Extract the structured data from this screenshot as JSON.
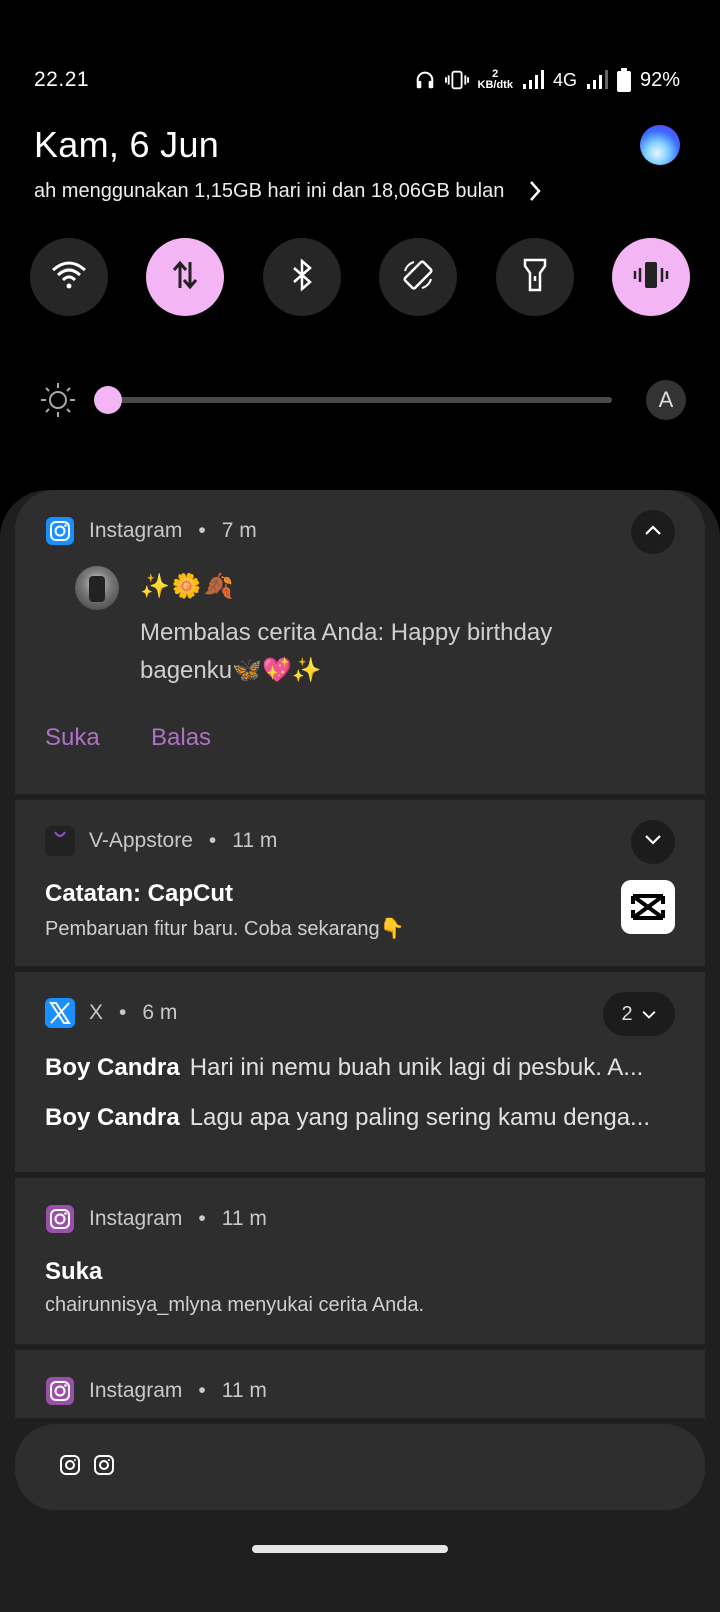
{
  "status": {
    "time": "22.21",
    "data_speed_value": "2",
    "data_speed_unit": "KB/dtk",
    "network": "4G",
    "battery": "92%"
  },
  "header": {
    "date": "Kam, 6 Jun",
    "data_usage": "ah menggunakan 1,15GB hari ini dan 18,06GB bulan"
  },
  "quick_toggles": [
    {
      "name": "wifi",
      "on": false
    },
    {
      "name": "mobile-data",
      "on": true
    },
    {
      "name": "bluetooth",
      "on": false
    },
    {
      "name": "auto-rotate",
      "on": false
    },
    {
      "name": "flashlight",
      "on": false
    },
    {
      "name": "vibrate",
      "on": true
    }
  ],
  "brightness": {
    "level": 0.0,
    "auto_label": "A"
  },
  "notifications": [
    {
      "app": "Instagram",
      "time": "7 m",
      "emoji_line": "✨🌼🍂",
      "message": "Membalas cerita Anda: Happy birthday bagenku🦋💖✨",
      "actions": [
        "Suka",
        "Balas"
      ]
    },
    {
      "app": "V-Appstore",
      "time": "11 m",
      "title": "Catatan: CapCut",
      "text": "Pembaruan fitur baru. Coba sekarang👇"
    },
    {
      "app": "X",
      "time": "6 m",
      "count": "2",
      "lines": [
        {
          "sender": "Boy Candra",
          "text": "Hari ini nemu buah unik lagi di pesbuk. A..."
        },
        {
          "sender": "Boy Candra",
          "text": "Lagu apa yang paling sering kamu denga..."
        }
      ]
    },
    {
      "app": "Instagram",
      "time": "11 m",
      "title": "Suka",
      "text": "chairunnisya_mlyna menyukai cerita Anda."
    },
    {
      "app": "Instagram",
      "time": "11 m"
    }
  ],
  "colors": {
    "accent": "#f4b5f4",
    "action_text": "#b070c8",
    "card_bg": "#2e2e2e",
    "panel_bg": "#1f1f1f"
  }
}
